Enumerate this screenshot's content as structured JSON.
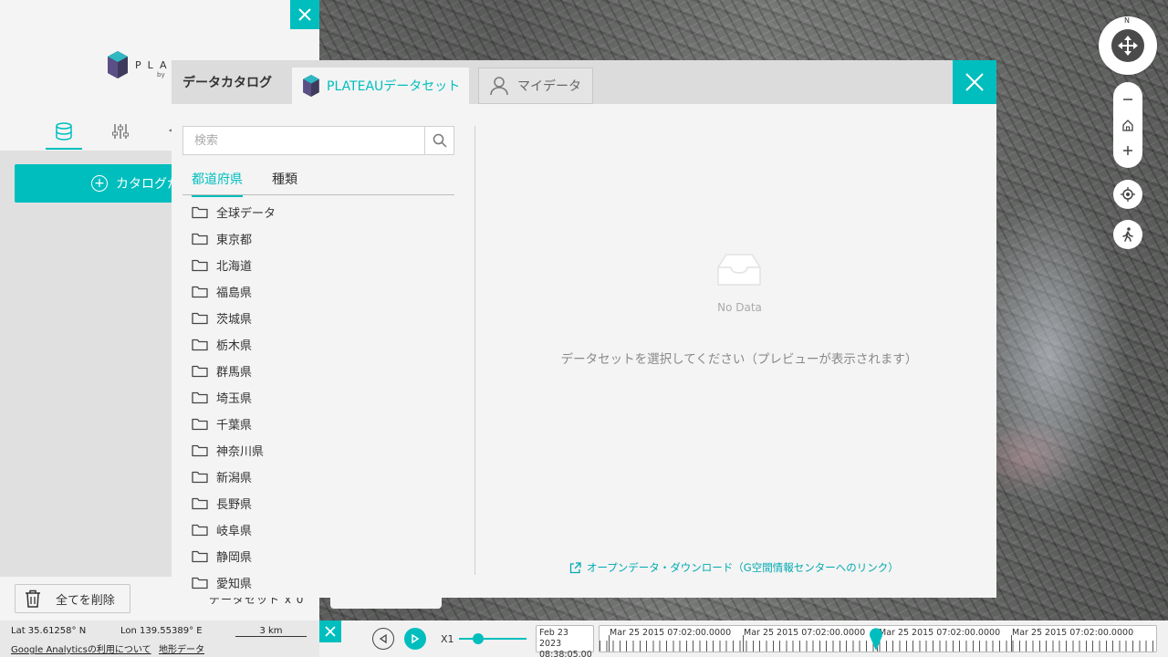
{
  "left_panel": {
    "logo_text": "PLATEAU",
    "logo_sub": "by",
    "catalog_button": "カタログか",
    "delete_all": "全てを削除",
    "dataset_count": "データセット x 0",
    "stub_text": "- -"
  },
  "status": {
    "lat": "Lat  35.61258° N",
    "lon": "Lon  139.55389° E",
    "scale": "3 km",
    "ga_link": "Google Analyticsの利用について",
    "terrain_link": "地形データ"
  },
  "modal": {
    "title": "データカタログ",
    "tabs": [
      {
        "label": "PLATEAUデータセット",
        "active": true
      },
      {
        "label": "マイデータ",
        "active": false
      }
    ],
    "search_placeholder": "検索",
    "category_tabs": [
      "都道府県",
      "種類"
    ],
    "tree_items": [
      "全球データ",
      "東京都",
      "北海道",
      "福島県",
      "茨城県",
      "栃木県",
      "群馬県",
      "埼玉県",
      "千葉県",
      "神奈川県",
      "新潟県",
      "長野県",
      "岐阜県",
      "静岡県",
      "愛知県"
    ],
    "no_data": "No Data",
    "preview_hint": "データセットを選択してください（プレビューが表示されます）",
    "open_data_link": "オープンデータ・ダウンロード（G空間情報センターへのリンク）"
  },
  "timeline": {
    "speed_label": "X1",
    "date_line1": "Feb 23 2023",
    "date_line2": "08:38:05.00",
    "tick_labels": [
      "Mar 25 2015 07:02:00.0000",
      "Mar 25 2015 07:02:00.0000",
      "Mar 25 2015 07:02:00.0000",
      "Mar 25 2015 07:02:00.0000"
    ]
  },
  "map_controls": {
    "compass_north": "N"
  },
  "colors": {
    "accent": "#00bebe",
    "panel": "#f4f4f4"
  }
}
